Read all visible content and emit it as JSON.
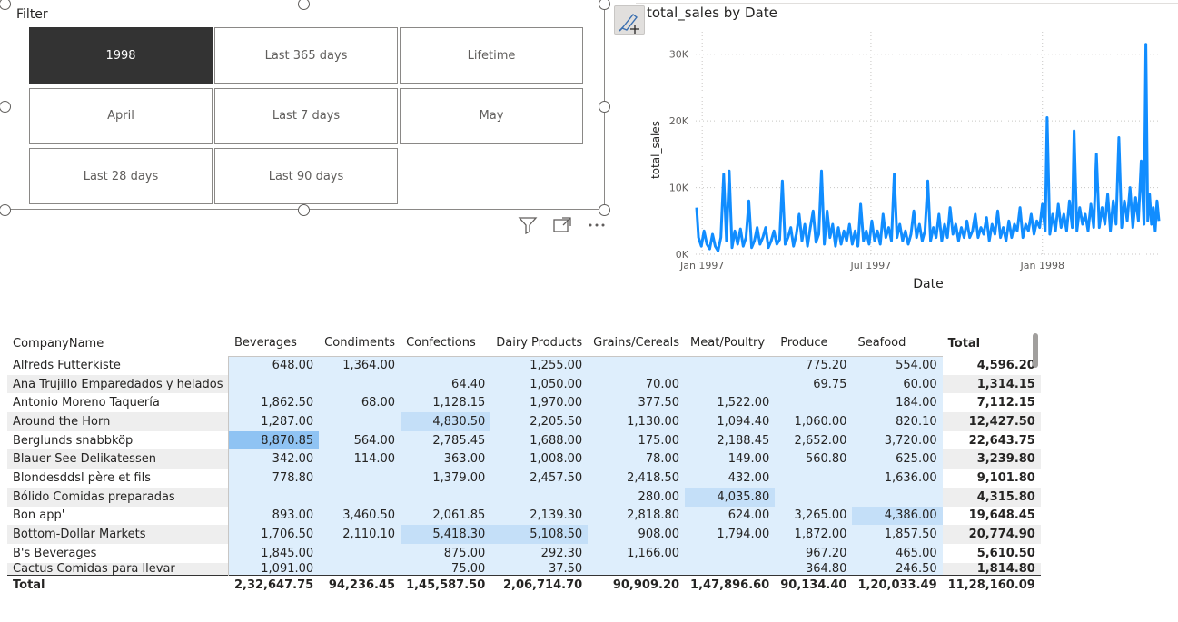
{
  "slicer": {
    "title": "Filter",
    "buttons": [
      "1998",
      "Last 365 days",
      "Lifetime",
      "April",
      "Last 7 days",
      "May",
      "Last 28 days",
      "Last 90 days"
    ],
    "selected_index": 0,
    "icons": [
      "filter-icon",
      "focus-mode-icon",
      "more-options-icon"
    ]
  },
  "chart": {
    "title": "total_sales by Date"
  },
  "chart_data": {
    "type": "line",
    "title": "total_sales by Date",
    "xlabel": "Date",
    "ylabel": "total_sales",
    "x_tick_labels": [
      "Jan 1997",
      "Jul 1997",
      "Jan 1998"
    ],
    "y_tick_labels": [
      "0K",
      "10K",
      "20K",
      "30K"
    ],
    "ylim": [
      0,
      32000
    ],
    "xlim": [
      "1996-12-25",
      "1998-05-06"
    ],
    "color": "#118DFF",
    "grid": "dotted",
    "series": [
      {
        "points": [
          [
            "1996-12-26",
            7000
          ],
          [
            "1996-12-28",
            2500
          ],
          [
            "1996-12-31",
            1200
          ],
          [
            "1997-01-03",
            3500
          ],
          [
            "1997-01-06",
            1500
          ],
          [
            "1997-01-09",
            800
          ],
          [
            "1997-01-12",
            3000
          ],
          [
            "1997-01-15",
            1200
          ],
          [
            "1997-01-18",
            500
          ],
          [
            "1997-01-21",
            2500
          ],
          [
            "1997-01-24",
            12000
          ],
          [
            "1997-01-27",
            2000
          ],
          [
            "1997-01-30",
            12500
          ],
          [
            "1997-02-02",
            1000
          ],
          [
            "1997-02-05",
            3500
          ],
          [
            "1997-02-08",
            1500
          ],
          [
            "1997-02-11",
            3800
          ],
          [
            "1997-02-14",
            1200
          ],
          [
            "1997-02-17",
            2500
          ],
          [
            "1997-02-20",
            8000
          ],
          [
            "1997-02-23",
            1000
          ],
          [
            "1997-02-26",
            2000
          ],
          [
            "1997-03-01",
            4000
          ],
          [
            "1997-03-04",
            1500
          ],
          [
            "1997-03-07",
            2500
          ],
          [
            "1997-03-10",
            4000
          ],
          [
            "1997-03-13",
            1000
          ],
          [
            "1997-03-16",
            2000
          ],
          [
            "1997-03-19",
            3500
          ],
          [
            "1997-03-22",
            1500
          ],
          [
            "1997-03-25",
            2200
          ],
          [
            "1997-03-28",
            11000
          ],
          [
            "1997-03-31",
            1500
          ],
          [
            "1997-04-03",
            2500
          ],
          [
            "1997-04-06",
            4000
          ],
          [
            "1997-04-09",
            1200
          ],
          [
            "1997-04-12",
            3000
          ],
          [
            "1997-04-15",
            6000
          ],
          [
            "1997-04-18",
            2000
          ],
          [
            "1997-04-21",
            4500
          ],
          [
            "1997-04-24",
            1200
          ],
          [
            "1997-04-27",
            4000
          ],
          [
            "1997-04-30",
            6500
          ],
          [
            "1997-05-03",
            1800
          ],
          [
            "1997-05-06",
            3000
          ],
          [
            "1997-05-09",
            12500
          ],
          [
            "1997-05-12",
            1500
          ],
          [
            "1997-05-15",
            6500
          ],
          [
            "1997-05-18",
            2500
          ],
          [
            "1997-05-21",
            4500
          ],
          [
            "1997-05-24",
            1200
          ],
          [
            "1997-05-27",
            4000
          ],
          [
            "1997-05-30",
            1500
          ],
          [
            "1997-06-02",
            3500
          ],
          [
            "1997-06-05",
            2000
          ],
          [
            "1997-06-08",
            4500
          ],
          [
            "1997-06-11",
            1500
          ],
          [
            "1997-06-14",
            3500
          ],
          [
            "1997-06-17",
            1200
          ],
          [
            "1997-06-20",
            7500
          ],
          [
            "1997-06-23",
            2000
          ],
          [
            "1997-06-26",
            3500
          ],
          [
            "1997-06-29",
            1500
          ],
          [
            "1997-07-02",
            5000
          ],
          [
            "1997-07-05",
            2000
          ],
          [
            "1997-07-08",
            3500
          ],
          [
            "1997-07-11",
            1500
          ],
          [
            "1997-07-14",
            6000
          ],
          [
            "1997-07-17",
            2500
          ],
          [
            "1997-07-20",
            4000
          ],
          [
            "1997-07-23",
            2000
          ],
          [
            "1997-07-26",
            12000
          ],
          [
            "1997-07-29",
            2500
          ],
          [
            "1997-08-01",
            4500
          ],
          [
            "1997-08-04",
            2000
          ],
          [
            "1997-08-07",
            3500
          ],
          [
            "1997-08-10",
            1500
          ],
          [
            "1997-08-13",
            3000
          ],
          [
            "1997-08-16",
            6500
          ],
          [
            "1997-08-19",
            2500
          ],
          [
            "1997-08-22",
            4500
          ],
          [
            "1997-08-25",
            2000
          ],
          [
            "1997-08-28",
            3500
          ],
          [
            "1997-08-31",
            11000
          ],
          [
            "1997-09-03",
            2000
          ],
          [
            "1997-09-06",
            4000
          ],
          [
            "1997-09-09",
            2500
          ],
          [
            "1997-09-12",
            6000
          ],
          [
            "1997-09-15",
            2000
          ],
          [
            "1997-09-18",
            4500
          ],
          [
            "1997-09-21",
            2500
          ],
          [
            "1997-09-24",
            7000
          ],
          [
            "1997-09-27",
            3000
          ],
          [
            "1997-09-30",
            4500
          ],
          [
            "1997-10-03",
            2000
          ],
          [
            "1997-10-06",
            4000
          ],
          [
            "1997-10-09",
            2500
          ],
          [
            "1997-10-12",
            5000
          ],
          [
            "1997-10-15",
            2500
          ],
          [
            "1997-10-18",
            3500
          ],
          [
            "1997-10-21",
            6000
          ],
          [
            "1997-10-24",
            2500
          ],
          [
            "1997-10-27",
            4000
          ],
          [
            "1997-10-30",
            3000
          ],
          [
            "1997-11-02",
            5500
          ],
          [
            "1997-11-05",
            2000
          ],
          [
            "1997-11-08",
            4500
          ],
          [
            "1997-11-11",
            3000
          ],
          [
            "1997-11-14",
            6500
          ],
          [
            "1997-11-17",
            2500
          ],
          [
            "1997-11-20",
            4000
          ],
          [
            "1997-11-23",
            2000
          ],
          [
            "1997-11-26",
            5000
          ],
          [
            "1997-11-29",
            2500
          ],
          [
            "1997-12-02",
            4500
          ],
          [
            "1997-12-05",
            3500
          ],
          [
            "1997-12-08",
            7000
          ],
          [
            "1997-12-11",
            2500
          ],
          [
            "1997-12-14",
            4500
          ],
          [
            "1997-12-17",
            3500
          ],
          [
            "1997-12-20",
            6000
          ],
          [
            "1997-12-23",
            3000
          ],
          [
            "1997-12-26",
            5000
          ],
          [
            "1997-12-29",
            4000
          ],
          [
            "1998-01-01",
            7500
          ],
          [
            "1998-01-04",
            3500
          ],
          [
            "1998-01-06",
            20500
          ],
          [
            "1998-01-09",
            3000
          ],
          [
            "1998-01-12",
            6000
          ],
          [
            "1998-01-15",
            3500
          ],
          [
            "1998-01-18",
            7500
          ],
          [
            "1998-01-21",
            4000
          ],
          [
            "1998-01-24",
            6000
          ],
          [
            "1998-01-27",
            3500
          ],
          [
            "1998-01-30",
            8000
          ],
          [
            "1998-02-02",
            4000
          ],
          [
            "1998-02-04",
            18500
          ],
          [
            "1998-02-07",
            3500
          ],
          [
            "1998-02-10",
            7000
          ],
          [
            "1998-02-13",
            4500
          ],
          [
            "1998-02-16",
            6000
          ],
          [
            "1998-02-19",
            3500
          ],
          [
            "1998-02-22",
            7500
          ],
          [
            "1998-02-25",
            4000
          ],
          [
            "1998-02-28",
            15000
          ],
          [
            "1998-03-03",
            4000
          ],
          [
            "1998-03-06",
            7000
          ],
          [
            "1998-03-09",
            4500
          ],
          [
            "1998-03-12",
            9000
          ],
          [
            "1998-03-15",
            3500
          ],
          [
            "1998-03-18",
            8000
          ],
          [
            "1998-03-21",
            4500
          ],
          [
            "1998-03-24",
            17500
          ],
          [
            "1998-03-27",
            4000
          ],
          [
            "1998-03-30",
            8000
          ],
          [
            "1998-04-02",
            5000
          ],
          [
            "1998-04-05",
            10000
          ],
          [
            "1998-04-08",
            4000
          ],
          [
            "1998-04-11",
            8500
          ],
          [
            "1998-04-14",
            5000
          ],
          [
            "1998-04-17",
            14000
          ],
          [
            "1998-04-20",
            4500
          ],
          [
            "1998-04-22",
            31500
          ],
          [
            "1998-04-24",
            5000
          ],
          [
            "1998-04-26",
            9000
          ],
          [
            "1998-04-28",
            4500
          ],
          [
            "1998-04-30",
            7000
          ],
          [
            "1998-05-02",
            3500
          ],
          [
            "1998-05-04",
            8000
          ],
          [
            "1998-05-06",
            5000
          ]
        ]
      }
    ]
  },
  "matrix": {
    "headers": [
      "CompanyName",
      "Beverages",
      "Condiments",
      "Confections",
      "Dairy Products",
      "Grains/Cereals",
      "Meat/Poultry",
      "Produce",
      "Seafood",
      "Total"
    ],
    "rows": [
      [
        "Alfreds Futterkiste",
        "648.00",
        "1,364.00",
        "",
        "1,255.00",
        "",
        "",
        "775.20",
        "554.00",
        "4,596.20"
      ],
      [
        "Ana Trujillo Emparedados y helados",
        "",
        "",
        "64.40",
        "1,050.00",
        "70.00",
        "",
        "69.75",
        "60.00",
        "1,314.15"
      ],
      [
        "Antonio Moreno Taquería",
        "1,862.50",
        "68.00",
        "1,128.15",
        "1,970.00",
        "377.50",
        "1,522.00",
        "",
        "184.00",
        "7,112.15"
      ],
      [
        "Around the Horn",
        "1,287.00",
        "",
        "4,830.50",
        "2,205.50",
        "1,130.00",
        "1,094.40",
        "1,060.00",
        "820.10",
        "12,427.50"
      ],
      [
        "Berglunds snabbköp",
        "8,870.85",
        "564.00",
        "2,785.45",
        "1,688.00",
        "175.00",
        "2,188.45",
        "2,652.00",
        "3,720.00",
        "22,643.75"
      ],
      [
        "Blauer See Delikatessen",
        "342.00",
        "114.00",
        "363.00",
        "1,008.00",
        "78.00",
        "149.00",
        "560.80",
        "625.00",
        "3,239.80"
      ],
      [
        "Blondesddsl père et fils",
        "778.80",
        "",
        "1,379.00",
        "2,457.50",
        "2,418.50",
        "432.00",
        "",
        "1,636.00",
        "9,101.80"
      ],
      [
        "Bólido Comidas preparadas",
        "",
        "",
        "",
        "",
        "280.00",
        "4,035.80",
        "",
        "",
        "4,315.80"
      ],
      [
        "Bon app'",
        "893.00",
        "3,460.50",
        "2,061.85",
        "2,139.30",
        "2,818.80",
        "624.00",
        "3,265.00",
        "4,386.00",
        "19,648.45"
      ],
      [
        "Bottom-Dollar Markets",
        "1,706.50",
        "2,110.10",
        "5,418.30",
        "5,108.50",
        "908.00",
        "1,794.00",
        "1,872.00",
        "1,857.50",
        "20,774.90"
      ],
      [
        "B's Beverages",
        "1,845.00",
        "",
        "875.00",
        "292.30",
        "1,166.00",
        "",
        "967.20",
        "465.00",
        "5,610.50"
      ],
      [
        "Cactus Comidas para llevar",
        "1,091.00",
        "",
        "75.00",
        "37.50",
        "",
        "",
        "364.80",
        "246.50",
        "1,814.80"
      ]
    ],
    "total_row": [
      "Total",
      "2,32,647.75",
      "94,236.45",
      "1,45,587.50",
      "2,06,714.70",
      "90,909.20",
      "1,47,896.60",
      "90,134.40",
      "1,20,033.49",
      "11,28,160.09"
    ],
    "highlight_colors": {
      "base": "#deeefc",
      "medium": "#c4dff8",
      "strong": "#8fc3f3"
    }
  }
}
